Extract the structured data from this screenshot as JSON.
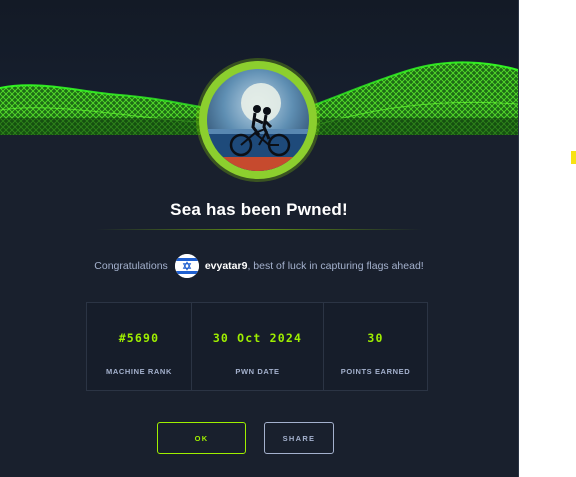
{
  "modal": {
    "title": "Sea has been Pwned!",
    "congrats_prefix": "Congratulations",
    "username": "evyatar9",
    "congrats_suffix": ", best of luck in capturing flags ahead!",
    "avatar_icon": "machine-sea-bicycle-icon",
    "flag_icon": "israel-flag-icon"
  },
  "stats": [
    {
      "value": "#5690",
      "label": "MACHINE RANK"
    },
    {
      "value": "30 Oct 2024",
      "label": "PWN DATE"
    },
    {
      "value": "30",
      "label": "POINTS EARNED"
    }
  ],
  "buttons": {
    "ok_label": "OK",
    "share_label": "SHARE"
  },
  "colors": {
    "accent": "#9fef00",
    "background": "#19202d",
    "muted_text": "#a4b1cd",
    "border": "#2b3444"
  }
}
